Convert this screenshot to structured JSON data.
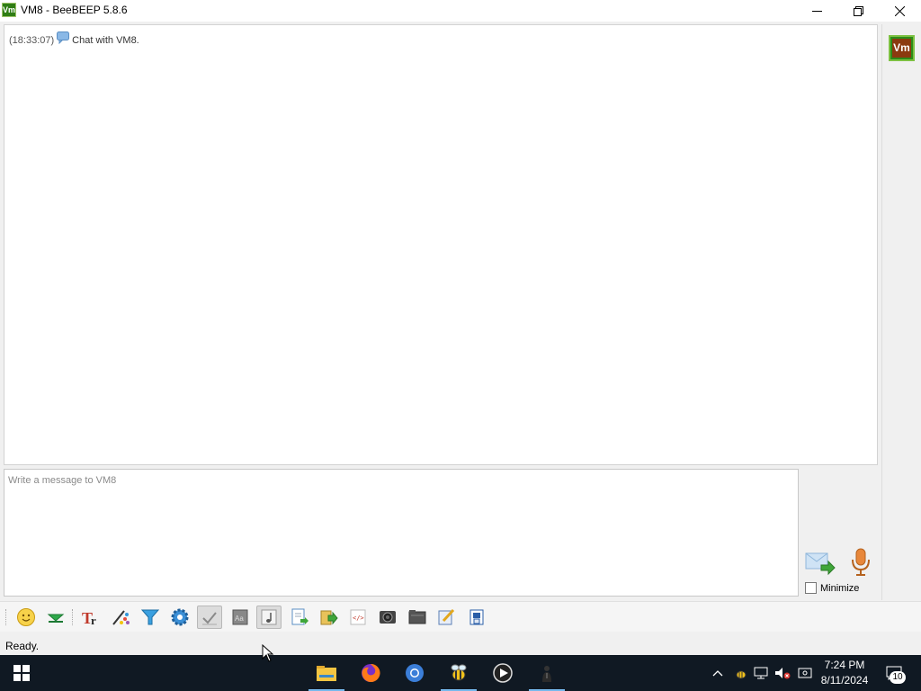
{
  "window": {
    "title": "VM8 - BeeBEEP 5.8.6",
    "app_icon_text": "Vm"
  },
  "chat": {
    "messages": [
      {
        "time": "(18:33:07)",
        "icon": "chat-bubble-icon",
        "text": "Chat with VM8."
      }
    ]
  },
  "users": [
    {
      "initials": "Vm",
      "color": "#8b3a0f"
    }
  ],
  "composer": {
    "placeholder": "Write a message to VM8",
    "minimize_label": "Minimize"
  },
  "toolbar": {
    "items": [
      "emoticons-icon",
      "collapse-icon",
      "font-icon",
      "font-color-icon",
      "filter-icon",
      "settings-icon",
      "spell-check-icon",
      "dictionary-icon",
      "music-note-icon",
      "save-chat-icon",
      "send-file-icon",
      "code-icon",
      "screenshot-icon",
      "folder-icon",
      "edit-icon",
      "clear-icon"
    ]
  },
  "status": {
    "text": "Ready."
  },
  "taskbar": {
    "apps": [
      "file-explorer-icon",
      "firefox-icon",
      "chrome-icon",
      "beebeep-icon",
      "media-player-icon",
      "user-icon"
    ],
    "clock_time": "7:24 PM",
    "clock_date": "8/11/2024",
    "notifications": "10"
  },
  "colors": {
    "accent": "#76b9ed",
    "taskbar": "#101923",
    "avatar_bg": "#2c8c18"
  }
}
